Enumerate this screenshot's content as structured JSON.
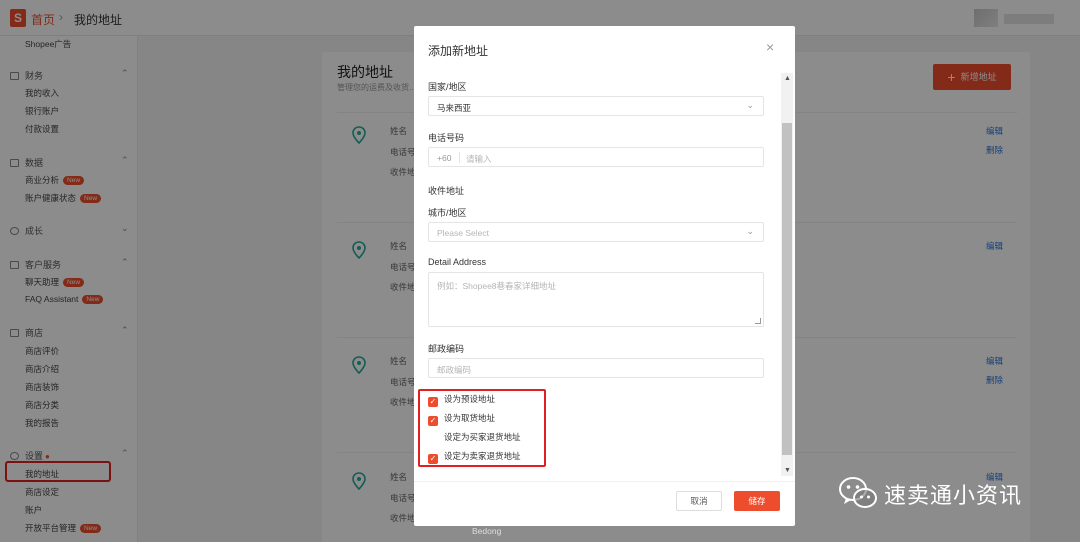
{
  "topbar": {
    "logo": "S",
    "home": "首页",
    "sep": "›",
    "current": "我的地址"
  },
  "sidebar": {
    "items": [
      {
        "kind": "item",
        "label": "Shopee广告"
      },
      {
        "kind": "head",
        "label": "财务"
      },
      {
        "kind": "item",
        "label": "我的收入"
      },
      {
        "kind": "item",
        "label": "银行账户"
      },
      {
        "kind": "item",
        "label": "付款设置"
      },
      {
        "kind": "head",
        "label": "数据"
      },
      {
        "kind": "item",
        "label": "商业分析",
        "badge": "New"
      },
      {
        "kind": "item",
        "label": "账户健康状态",
        "badge": "New"
      },
      {
        "kind": "head",
        "label": "成长"
      },
      {
        "kind": "head",
        "label": "客户服务"
      },
      {
        "kind": "item",
        "label": "聊天助理",
        "badge": "New"
      },
      {
        "kind": "item",
        "label": "FAQ Assistant",
        "badge": "New"
      },
      {
        "kind": "head",
        "label": "商店"
      },
      {
        "kind": "item",
        "label": "商店评价"
      },
      {
        "kind": "item",
        "label": "商店介绍"
      },
      {
        "kind": "item",
        "label": "商店装饰"
      },
      {
        "kind": "item",
        "label": "商店分类"
      },
      {
        "kind": "item",
        "label": "我的报告"
      },
      {
        "kind": "head",
        "label": "设置"
      },
      {
        "kind": "item",
        "label": "我的地址"
      },
      {
        "kind": "item",
        "label": "商店设定"
      },
      {
        "kind": "item",
        "label": "账户"
      },
      {
        "kind": "item",
        "label": "开放平台管理",
        "badge": "New"
      }
    ]
  },
  "page": {
    "title": "我的地址",
    "subtitle": "管理您的运费及收货...",
    "add_button": "新增地址",
    "addr_labels": {
      "name": "姓名",
      "phone": "电话号",
      "address": "收件地"
    },
    "edit": "编辑",
    "delete": "删除",
    "bottom_text": "Bedong"
  },
  "modal": {
    "title": "添加新地址",
    "close": "×",
    "country_label": "国家/地区",
    "country_value": "马来西亚",
    "phone_label": "电话号码",
    "phone_prefix": "+60",
    "phone_placeholder": "请输入",
    "section_label": "收件地址",
    "city_label": "城市/地区",
    "city_placeholder": "Please Select",
    "detail_label": "Detail Address",
    "detail_placeholder": "例如：Shopee8巷春家详细地址",
    "postal_label": "邮政编码",
    "postal_placeholder": "邮政编码",
    "checkboxes": [
      {
        "label": "设为预设地址",
        "checked": true
      },
      {
        "label": "设为取货地址",
        "checked": true
      },
      {
        "label": "设定为买家退货地址",
        "checked": false
      },
      {
        "label": "设定为卖家退货地址",
        "checked": true
      }
    ],
    "cancel": "取消",
    "save": "储存"
  },
  "watermark": {
    "text": "速卖通小资讯"
  },
  "colors": {
    "accent": "#ee4d2d",
    "link": "#2673dd",
    "highlight": "#e02020"
  },
  "icons": [
    "location-pin-icon",
    "chevron-down-icon",
    "close-icon",
    "plus-icon",
    "wechat-icon"
  ]
}
